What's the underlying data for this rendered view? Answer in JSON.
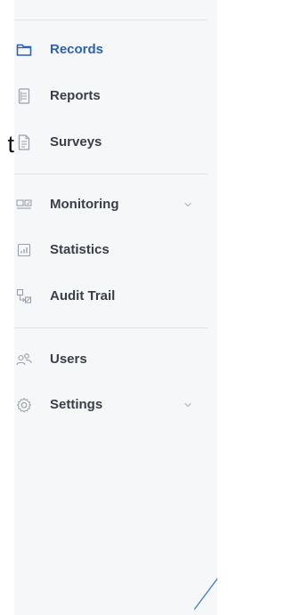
{
  "background_fragment": {
    "text": "t"
  },
  "sidebar": {
    "items": [
      {
        "label": "Records",
        "icon": "folder-icon",
        "active": true
      },
      {
        "label": "Reports",
        "icon": "report-icon",
        "active": false
      },
      {
        "label": "Surveys",
        "icon": "survey-icon",
        "active": false
      },
      {
        "label": "Monitoring",
        "icon": "monitor-icon",
        "active": false,
        "expandable": true
      },
      {
        "label": "Statistics",
        "icon": "bar-chart-icon",
        "active": false
      },
      {
        "label": "Audit Trail",
        "icon": "audit-trail-icon",
        "active": false
      },
      {
        "label": "Users",
        "icon": "users-icon",
        "active": false
      },
      {
        "label": "Settings",
        "icon": "gear-icon",
        "active": false,
        "expandable": true
      }
    ]
  },
  "colors": {
    "sidebar_bg": "#f6f7f9",
    "active_text": "#2d61b3",
    "text": "#3a3e46",
    "icon": "#9aa0aa",
    "divider": "#dfe2e7"
  }
}
